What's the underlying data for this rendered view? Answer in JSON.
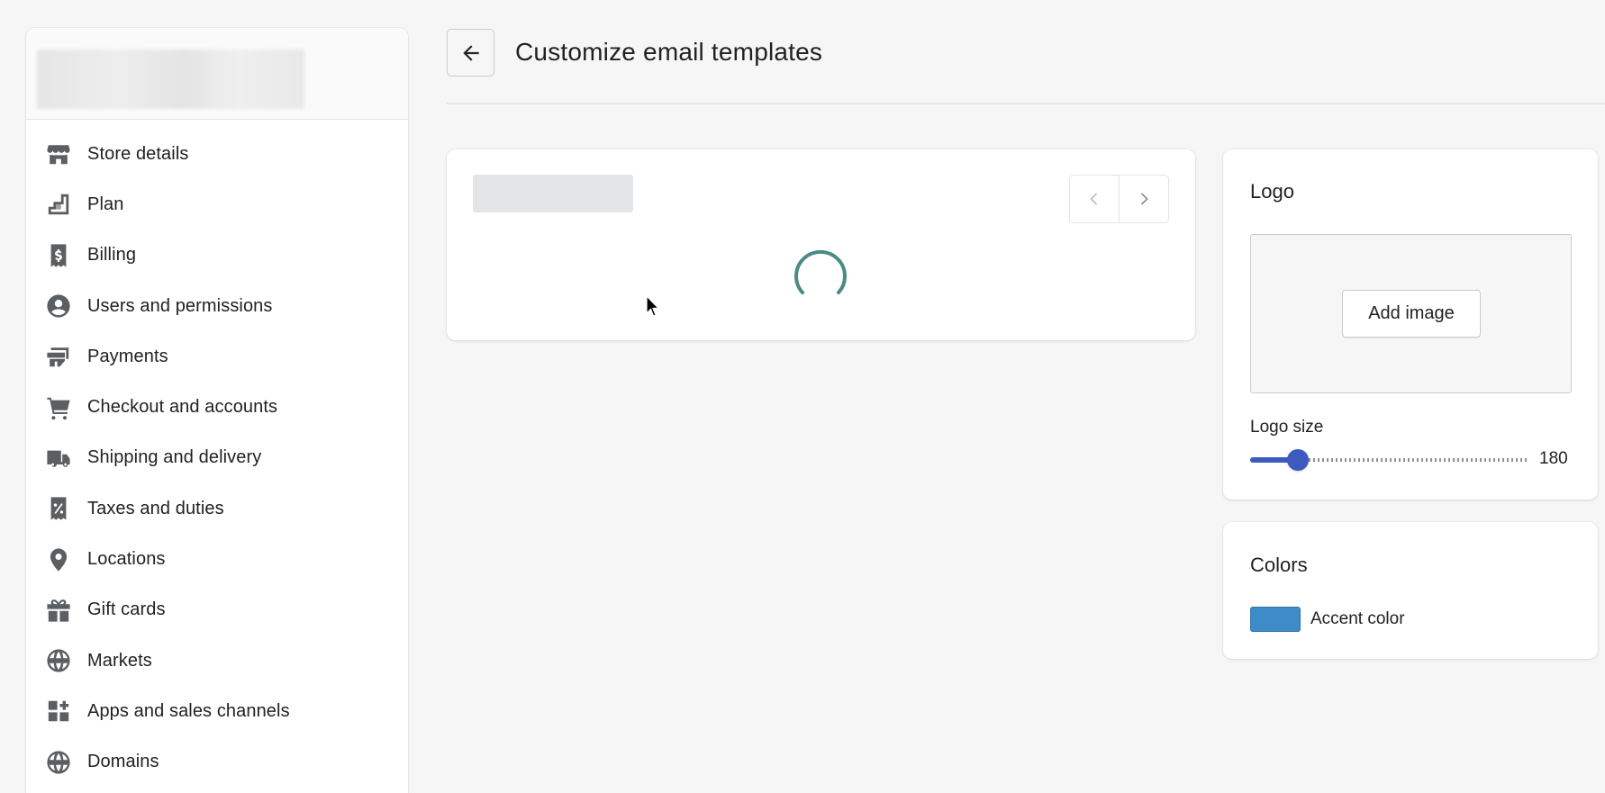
{
  "sidebar": {
    "items": [
      {
        "label": "Store details",
        "icon": "store-icon"
      },
      {
        "label": "Plan",
        "icon": "plan-icon"
      },
      {
        "label": "Billing",
        "icon": "billing-icon"
      },
      {
        "label": "Users and permissions",
        "icon": "user-icon"
      },
      {
        "label": "Payments",
        "icon": "payments-icon"
      },
      {
        "label": "Checkout and accounts",
        "icon": "cart-icon"
      },
      {
        "label": "Shipping and delivery",
        "icon": "truck-icon"
      },
      {
        "label": "Taxes and duties",
        "icon": "tax-receipt-icon"
      },
      {
        "label": "Locations",
        "icon": "location-pin-icon"
      },
      {
        "label": "Gift cards",
        "icon": "gift-icon"
      },
      {
        "label": "Markets",
        "icon": "globe-icon"
      },
      {
        "label": "Apps and sales channels",
        "icon": "apps-icon"
      },
      {
        "label": "Domains",
        "icon": "domain-globe-icon"
      }
    ]
  },
  "header": {
    "title": "Customize email templates",
    "back_icon": "arrow-left-icon"
  },
  "preview": {
    "prev_icon": "chevron-left-icon",
    "next_icon": "chevron-right-icon",
    "loading_icon": "spinner-icon"
  },
  "logo": {
    "title": "Logo",
    "add_image_label": "Add image",
    "size_label": "Logo size",
    "size_value": "180",
    "size_fraction": 0.17
  },
  "colors": {
    "title": "Colors",
    "accent_label": "Accent color",
    "accent_hex": "#3d8bc7"
  },
  "theme": {
    "slider_color": "#3d5bbf",
    "spinner_color": "#4b8a85"
  }
}
